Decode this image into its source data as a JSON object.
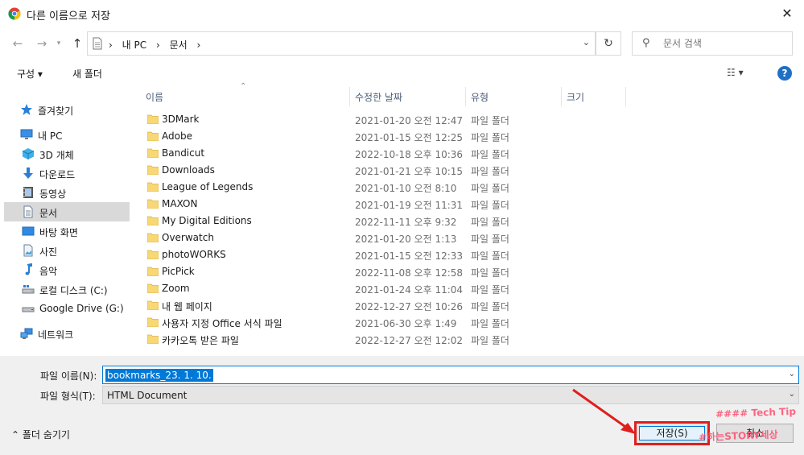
{
  "window": {
    "title": "다른 이름으로 저장",
    "close_glyph": "✕",
    "app_icon": "chrome-icon"
  },
  "address": {
    "crumbs": [
      "내 PC",
      "문서"
    ],
    "separator": "›",
    "search_placeholder": "문서 검색"
  },
  "toolbar": {
    "organize": "구성 ▾",
    "new_folder": "새 폴더",
    "help": "?"
  },
  "nav": {
    "items": [
      {
        "label": "즐겨찾기",
        "icon": "star-icon"
      },
      {
        "label": "내 PC",
        "icon": "computer-icon"
      },
      {
        "label": "3D 개체",
        "icon": "3d-objects-icon"
      },
      {
        "label": "다운로드",
        "icon": "download-icon"
      },
      {
        "label": "동영상",
        "icon": "video-icon"
      },
      {
        "label": "문서",
        "icon": "document-icon"
      },
      {
        "label": "바탕 화면",
        "icon": "desktop-icon"
      },
      {
        "label": "사진",
        "icon": "pictures-icon"
      },
      {
        "label": "음악",
        "icon": "music-icon"
      },
      {
        "label": "로컬 디스크 (C:)",
        "icon": "local-disk-icon"
      },
      {
        "label": "Google Drive (G:)",
        "icon": "drive-icon"
      },
      {
        "label": "네트워크",
        "icon": "network-icon"
      }
    ]
  },
  "columns": {
    "name": "이름",
    "date": "수정한 날짜",
    "type": "유형",
    "size": "크기"
  },
  "files": [
    {
      "name": "3DMark",
      "date": "2021-01-20 오전 12:47",
      "type": "파일 폴더"
    },
    {
      "name": "Adobe",
      "date": "2021-01-15 오전 12:25",
      "type": "파일 폴더"
    },
    {
      "name": "Bandicut",
      "date": "2022-10-18 오후 10:36",
      "type": "파일 폴더"
    },
    {
      "name": "Downloads",
      "date": "2021-01-21 오후 10:15",
      "type": "파일 폴더"
    },
    {
      "name": "League of Legends",
      "date": "2021-01-10 오전 8:10",
      "type": "파일 폴더"
    },
    {
      "name": "MAXON",
      "date": "2021-01-19 오전 11:31",
      "type": "파일 폴더"
    },
    {
      "name": "My Digital Editions",
      "date": "2022-11-11 오후 9:32",
      "type": "파일 폴더"
    },
    {
      "name": "Overwatch",
      "date": "2021-01-20 오전 1:13",
      "type": "파일 폴더"
    },
    {
      "name": "photoWORKS",
      "date": "2021-01-15 오전 12:33",
      "type": "파일 폴더"
    },
    {
      "name": "PicPick",
      "date": "2022-11-08 오후 12:58",
      "type": "파일 폴더"
    },
    {
      "name": "Zoom",
      "date": "2021-01-24 오후 11:04",
      "type": "파일 폴더"
    },
    {
      "name": "내 웹 페이지",
      "date": "2022-12-27 오전 10:26",
      "type": "파일 폴더"
    },
    {
      "name": "사용자 지정 Office 서식 파일",
      "date": "2021-06-30 오후 1:49",
      "type": "파일 폴더"
    },
    {
      "name": "카카오톡 받은 파일",
      "date": "2022-12-27 오전 12:02",
      "type": "파일 폴더"
    }
  ],
  "form": {
    "filename_label": "파일 이름(N):",
    "filename_value": "bookmarks_23. 1. 10.",
    "filetype_label": "파일 형식(T):",
    "filetype_value": "HTML Document",
    "hide_folders": "폴더 숨기기",
    "save": "저장(S)",
    "cancel": "취소"
  },
  "watermark": {
    "line1": "#### Tech Tip",
    "line2": "#하는STORY세상"
  },
  "colors": {
    "accent": "#0078d7",
    "highlight_box": "#e01e1e",
    "selected_nav": "#d9d9d9",
    "folder": "#f8d775"
  }
}
